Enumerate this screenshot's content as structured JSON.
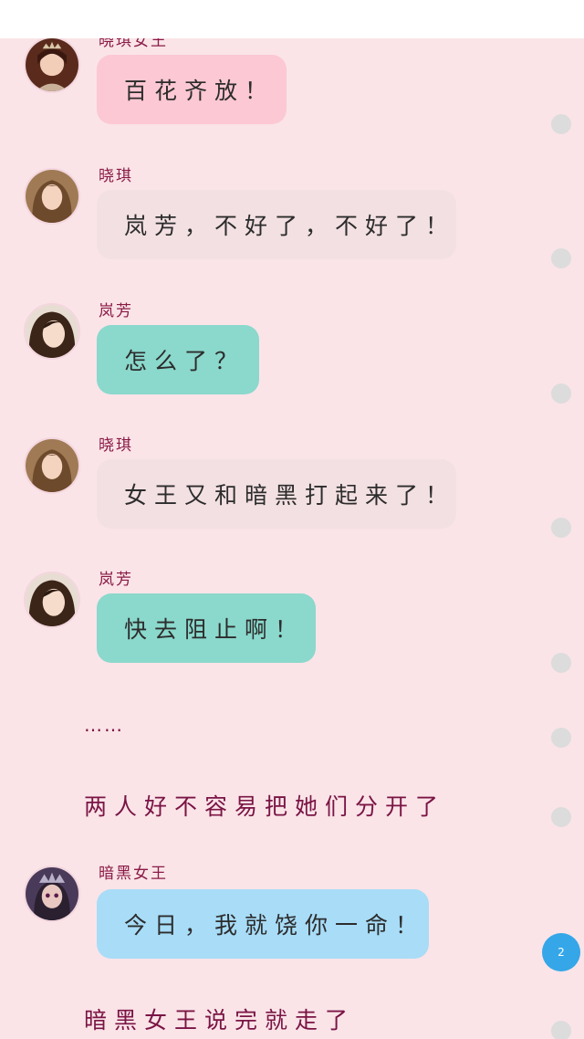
{
  "colors": {
    "background": "#fae4e8",
    "bubble_pink": "#fcc8d3",
    "bubble_beige": "#f3e0e2",
    "bubble_teal": "#8bd8cc",
    "bubble_blue": "#a8dcf7",
    "sender_text": "#8a1a45",
    "narration_text": "#7a1444",
    "badge": "#35a6e8"
  },
  "messages": [
    {
      "sender": "晓琪女王",
      "avatar": "queen-avatar",
      "text": "百花齐放！",
      "bubble": "pink"
    },
    {
      "sender": "晓琪",
      "avatar": "xiaoqi-avatar",
      "text": "岚芳，不好了，不好了！",
      "bubble": "beige"
    },
    {
      "sender": "岚芳",
      "avatar": "lanfang-avatar",
      "text": "怎么了？",
      "bubble": "teal"
    },
    {
      "sender": "晓琪",
      "avatar": "xiaoqi-avatar",
      "text": "女王又和暗黑打起来了！",
      "bubble": "beige"
    },
    {
      "sender": "岚芳",
      "avatar": "lanfang-avatar",
      "text": "快去阻止啊！",
      "bubble": "teal"
    },
    {
      "sender": "暗黑女王",
      "avatar": "dark-queen-avatar",
      "text": "今日，我就饶你一命！",
      "bubble": "blue"
    }
  ],
  "narration": [
    "……",
    "两人好不容易把她们分开了",
    "暗黑女王说完就走了"
  ],
  "badge": {
    "count": "2"
  }
}
